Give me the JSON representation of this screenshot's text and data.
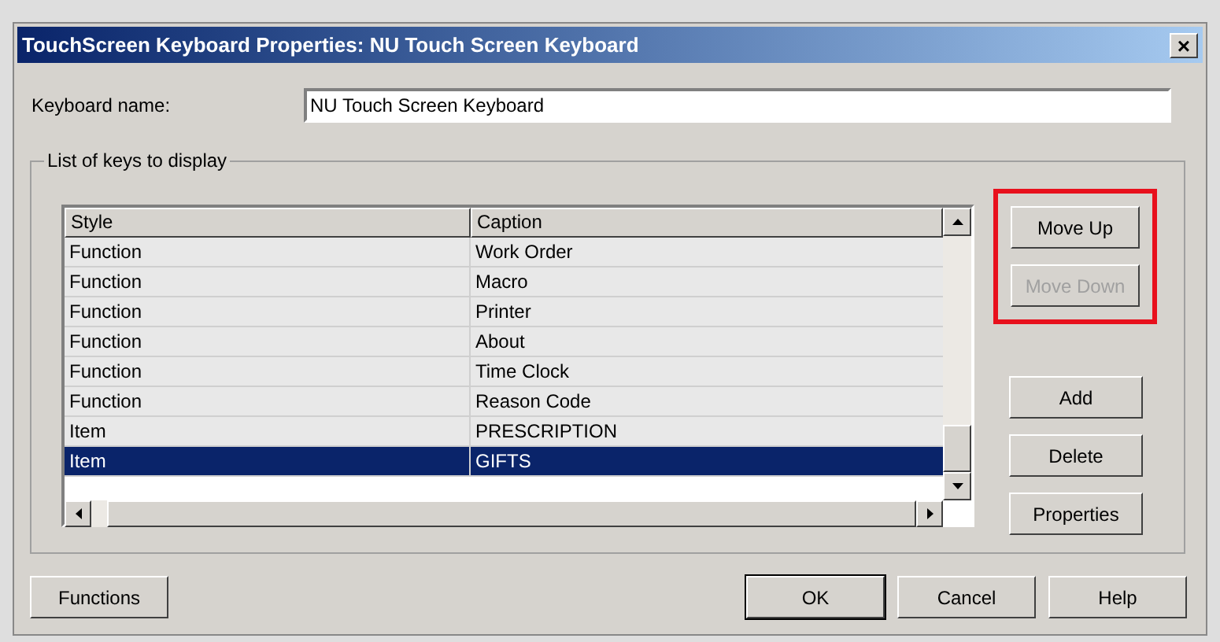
{
  "window": {
    "title": "TouchScreen Keyboard Properties: NU Touch Screen Keyboard",
    "close": "×"
  },
  "keyboard_name": {
    "label": "Keyboard name:",
    "value": "NU Touch Screen Keyboard"
  },
  "keys_group": {
    "title": "List of keys to display",
    "table": {
      "columns": [
        "Style",
        "Caption"
      ],
      "rows": [
        {
          "style": "Function",
          "caption": "Work Order",
          "selected": false
        },
        {
          "style": "Function",
          "caption": "Macro",
          "selected": false
        },
        {
          "style": "Function",
          "caption": "Printer",
          "selected": false
        },
        {
          "style": "Function",
          "caption": "About",
          "selected": false
        },
        {
          "style": "Function",
          "caption": "Time Clock",
          "selected": false
        },
        {
          "style": "Function",
          "caption": "Reason Code",
          "selected": false
        },
        {
          "style": "Item",
          "caption": "PRESCRIPTION",
          "selected": false
        },
        {
          "style": "Item",
          "caption": "GIFTS",
          "selected": true
        }
      ]
    },
    "move_buttons": {
      "highlighted": true,
      "buttons": [
        {
          "label": "Move Up",
          "disabled": false
        },
        {
          "label": "Move Down",
          "disabled": true
        }
      ]
    },
    "buttons": [
      {
        "label": "Add",
        "disabled": false
      },
      {
        "label": "Delete",
        "disabled": false
      },
      {
        "label": "Properties",
        "disabled": false
      }
    ]
  },
  "footer": {
    "left": [
      {
        "label": "Functions",
        "default": false
      }
    ],
    "right": [
      {
        "label": "OK",
        "default": true
      },
      {
        "label": "Cancel",
        "default": false
      },
      {
        "label": "Help",
        "default": false
      }
    ]
  }
}
